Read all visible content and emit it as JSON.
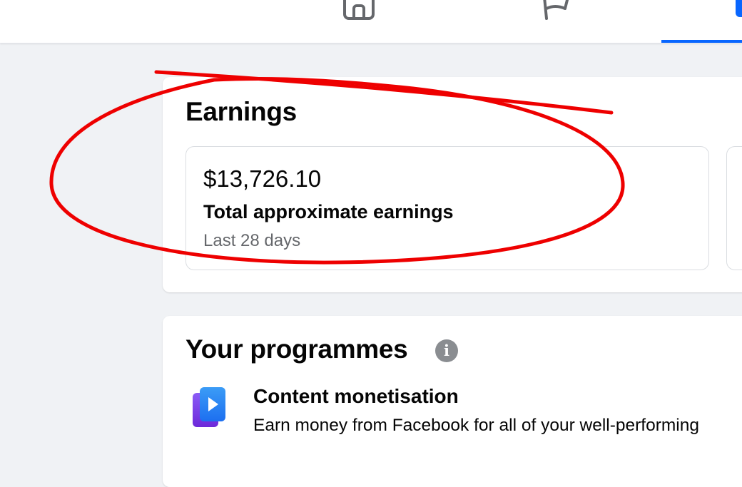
{
  "header": {
    "nav_icons": [
      "home-icon",
      "flag-icon",
      "active-tab-icon"
    ],
    "accent_color": "#0866ff"
  },
  "earnings": {
    "title": "Earnings",
    "stat": {
      "value": "$13,726.10",
      "label": "Total approximate earnings",
      "period": "Last 28 days"
    }
  },
  "programmes": {
    "title": "Your programmes",
    "info_glyph": "i",
    "items": [
      {
        "icon": "content-monetisation-icon",
        "title": "Content monetisation",
        "description": "Earn money from Facebook for all of your well-performing"
      }
    ]
  },
  "annotation": {
    "type": "hand-drawn red ellipse and strike line",
    "color": "#ee0000"
  }
}
